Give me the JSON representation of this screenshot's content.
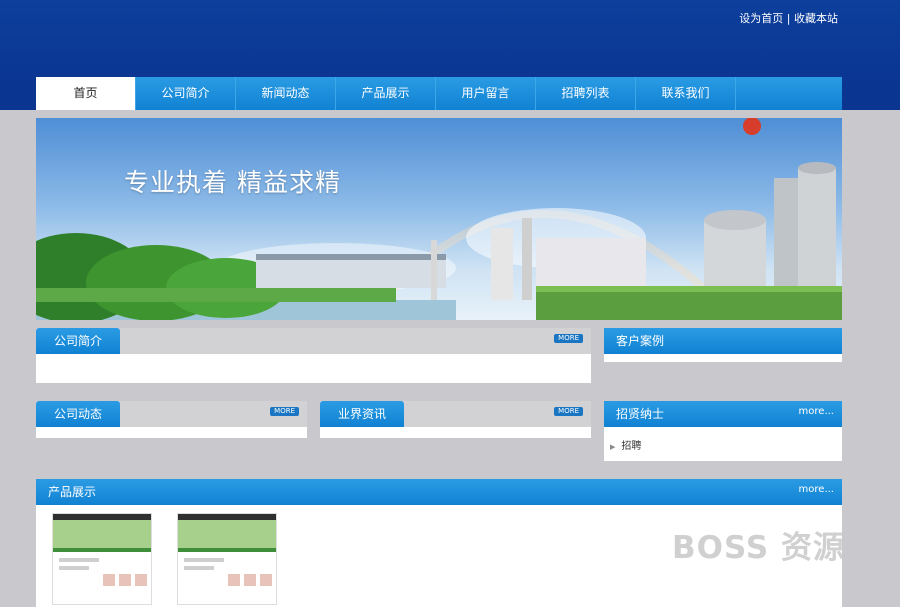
{
  "toplinks": {
    "set_home": "设为首页",
    "separator": "|",
    "bookmark": "收藏本站"
  },
  "nav": [
    "首页",
    "公司简介",
    "新闻动态",
    "产品展示",
    "用户留言",
    "招聘列表",
    "联系我们"
  ],
  "banner": {
    "slogan": "专业执着  精益求精"
  },
  "sections": {
    "company_intro": {
      "title": "公司简介",
      "more": "MORE"
    },
    "client_cases": {
      "title": "客户案例"
    },
    "company_news": {
      "title": "公司动态",
      "more": "MORE"
    },
    "industry_news": {
      "title": "业界资讯",
      "more": "MORE"
    },
    "recruit": {
      "title": "招贤纳士",
      "more": "more...",
      "items": [
        "招聘"
      ]
    },
    "products": {
      "title": "产品展示",
      "more": "more..."
    }
  },
  "watermark": "BOSS 资源",
  "colors": {
    "header_blue": "#0b3794",
    "nav_blue": "#1a8ad8",
    "page_bg": "#c9c9cd"
  }
}
